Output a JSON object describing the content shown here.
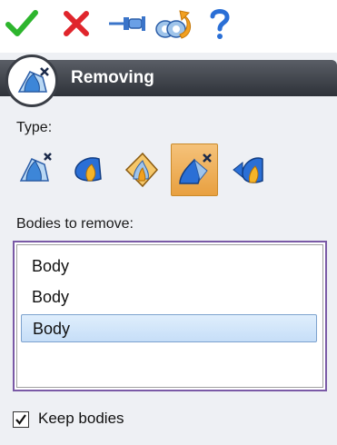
{
  "toolbar": {
    "buttons": [
      {
        "name": "ok",
        "icon": "check-icon",
        "color": "#2db52d"
      },
      {
        "name": "cancel",
        "icon": "x-icon",
        "color": "#e0252c"
      },
      {
        "name": "pin",
        "icon": "pushpin-icon",
        "color": "#3a74c9"
      },
      {
        "name": "preview",
        "icon": "preview-icon",
        "color": "#f2a020"
      },
      {
        "name": "help",
        "icon": "question-icon",
        "color": "#2a6fd6"
      }
    ]
  },
  "panel": {
    "title": "Removing",
    "type_label": "Type:",
    "type_options": [
      {
        "name": "remove-body",
        "selected": false
      },
      {
        "name": "remove-drop",
        "selected": false
      },
      {
        "name": "remove-sheet",
        "selected": false
      },
      {
        "name": "remove-fill",
        "selected": true
      },
      {
        "name": "remove-arrow",
        "selected": false
      }
    ],
    "bodies_label": "Bodies to remove:",
    "bodies": [
      {
        "label": "Body",
        "selected": false
      },
      {
        "label": "Body",
        "selected": false
      },
      {
        "label": "Body",
        "selected": true
      }
    ],
    "keep_bodies": {
      "label": "Keep bodies",
      "checked": true
    }
  },
  "colors": {
    "header": "#3a3e46",
    "list_border": "#7a5aa6",
    "selection": "#c6def8",
    "type_selected": "#e8a040"
  }
}
